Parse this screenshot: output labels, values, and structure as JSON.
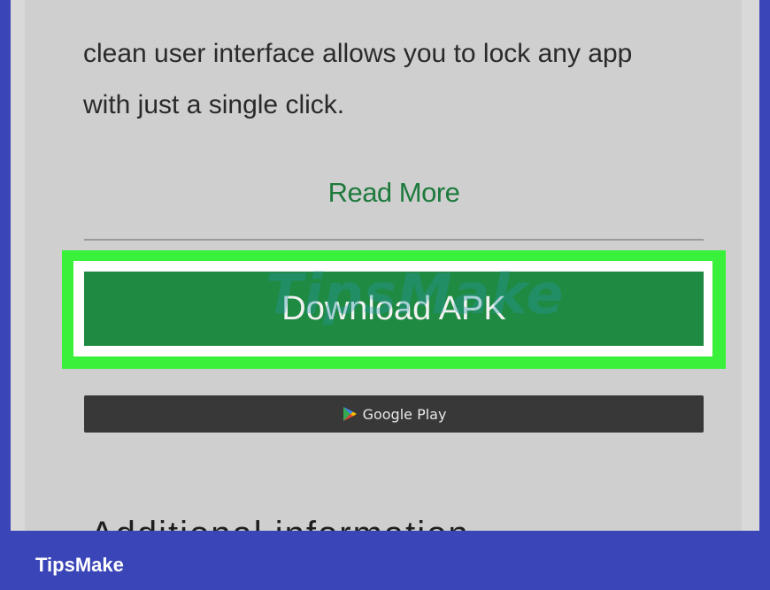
{
  "content": {
    "paragraph_line1": "clean user interface allows you to lock any app",
    "paragraph_line2": "with just a single click.",
    "read_more_label": "Read More",
    "download_label": "Download APK",
    "google_play_label": "Google Play",
    "cut_heading": "Additional information"
  },
  "watermark": "TipsMake",
  "footer": {
    "brand": "TipsMake"
  },
  "colors": {
    "frame": "#3a45b8",
    "page_bg": "#cfcfcf",
    "link_green": "#1d7a3c",
    "download_green": "#1f8a42",
    "highlight_green": "#39f03a",
    "google_play_dark": "#383838"
  },
  "icons": {
    "google_play": "google-play-icon"
  }
}
